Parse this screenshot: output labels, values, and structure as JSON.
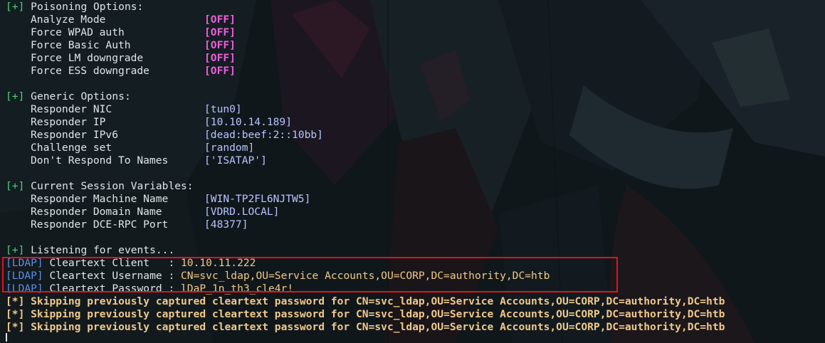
{
  "poisoning": {
    "header": "Poisoning Options:",
    "marker": "[+]",
    "options": [
      {
        "label": "Analyze Mode",
        "value": "[OFF]"
      },
      {
        "label": "Force WPAD auth",
        "value": "[OFF]"
      },
      {
        "label": "Force Basic Auth",
        "value": "[OFF]"
      },
      {
        "label": "Force LM downgrade",
        "value": "[OFF]"
      },
      {
        "label": "Force ESS downgrade",
        "value": "[OFF]"
      }
    ]
  },
  "generic": {
    "header": "Generic Options:",
    "marker": "[+]",
    "options": [
      {
        "label": "Responder NIC",
        "value": "[tun0]"
      },
      {
        "label": "Responder IP",
        "value": "[10.10.14.189]"
      },
      {
        "label": "Responder IPv6",
        "value": "[dead:beef:2::10bb]"
      },
      {
        "label": "Challenge set",
        "value": "[random]"
      },
      {
        "label": "Don't Respond To Names",
        "value": "['ISATAP']"
      }
    ]
  },
  "session": {
    "header": "Current Session Variables:",
    "marker": "[+]",
    "options": [
      {
        "label": "Responder Machine Name",
        "value": "[WIN-TP2FL6NJTW5]"
      },
      {
        "label": "Responder Domain Name",
        "value": "[VDRD.LOCAL]"
      },
      {
        "label": "Responder DCE-RPC Port",
        "value": "[48377]"
      }
    ]
  },
  "listening": {
    "marker": "[+]",
    "text": "Listening for events..."
  },
  "ldap": [
    {
      "tag": "[LDAP]",
      "text": " Cleartext Client   : ",
      "value": "10.10.11.222"
    },
    {
      "tag": "[LDAP]",
      "text": " Cleartext Username : ",
      "value": "CN=svc_ldap,OU=Service Accounts,OU=CORP,DC=authority,DC=htb"
    },
    {
      "tag": "[LDAP]",
      "text": " Cleartext Password : ",
      "value": "lDaP_1n_th3_cle4r!"
    }
  ],
  "skipped": [
    "[*] Skipping previously captured cleartext password for CN=svc_ldap,OU=Service Accounts,OU=CORP,DC=authority,DC=htb",
    "[*] Skipping previously captured cleartext password for CN=svc_ldap,OU=Service Accounts,OU=CORP,DC=authority,DC=htb",
    "[*] Skipping previously captured cleartext password for CN=svc_ldap,OU=Service Accounts,OU=CORP,DC=authority,DC=htb"
  ],
  "colors": {
    "background": "#0f1519",
    "marker": "#4fd07a",
    "off_value": "#ee5fdc",
    "setting_value": "#b7c5ff",
    "ldap_tag": "#5c8ee8",
    "captured_value": "#f0c98a",
    "highlight_box": "#e0141b"
  }
}
